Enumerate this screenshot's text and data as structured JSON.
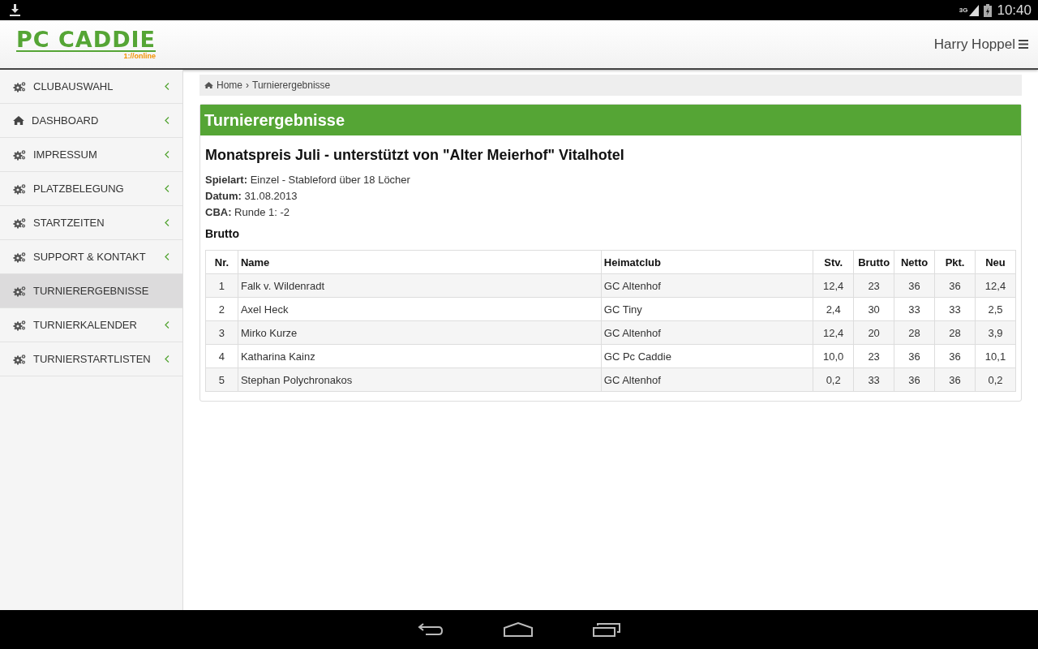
{
  "status_bar": {
    "network": "3G",
    "time": "10:40"
  },
  "header": {
    "logo": "PC CADDIE",
    "logo_sub": "1://online",
    "user": "Harry Hoppel"
  },
  "sidebar": {
    "items": [
      {
        "label": "CLUBAUSWAHL",
        "kind": "gears",
        "selected": false
      },
      {
        "label": "DASHBOARD",
        "kind": "home",
        "selected": false
      },
      {
        "label": "IMPRESSUM",
        "kind": "gears",
        "selected": false
      },
      {
        "label": "PLATZBELEGUNG",
        "kind": "gears",
        "selected": false
      },
      {
        "label": "STARTZEITEN",
        "kind": "gears",
        "selected": false
      },
      {
        "label": "SUPPORT & KONTAKT",
        "kind": "gears",
        "selected": false
      },
      {
        "label": "TURNIERERGEBNISSE",
        "kind": "gears",
        "selected": true
      },
      {
        "label": "TURNIERKALENDER",
        "kind": "gears",
        "selected": false
      },
      {
        "label": "TURNIERSTARTLISTEN",
        "kind": "gears",
        "selected": false
      }
    ]
  },
  "breadcrumb": [
    "Home",
    "›",
    "Turnierergebnisse"
  ],
  "panel": {
    "title": "Turnierergebnisse",
    "heading": "Monatspreis Juli - unterstützt von \"Alter Meierhof\" Vitalhotel",
    "details": [
      "**Spielart:** Einzel - Stableford über 18 Löcher",
      "**Datum:** 31.08.2013",
      "**CBA:** Runde 1: -2"
    ],
    "section": "Brutto",
    "table": {
      "columns": [
        {
          "label": "Nr.",
          "kind": "number"
        },
        {
          "label": "Name",
          "kind": "text"
        },
        {
          "label": "Heimatclub",
          "kind": "text"
        },
        {
          "label": "Stv.",
          "kind": "number"
        },
        {
          "label": "Brutto",
          "kind": "number"
        },
        {
          "label": "Netto",
          "kind": "number"
        },
        {
          "label": "Pkt.",
          "kind": "number"
        },
        {
          "label": "Neu",
          "kind": "number"
        }
      ],
      "rows": [
        [
          "1",
          "Falk v. Wildenradt",
          "GC Altenhof",
          "12,4",
          "23",
          "36",
          "36",
          "12,4"
        ],
        [
          "2",
          "Axel Heck",
          "GC Tiny",
          "2,4",
          "30",
          "33",
          "33",
          "2,5"
        ],
        [
          "3",
          "Mirko Kurze",
          "GC Altenhof",
          "12,4",
          "20",
          "28",
          "28",
          "3,9"
        ],
        [
          "4",
          "Katharina Kainz",
          "GC Pc Caddie",
          "10,0",
          "23",
          "36",
          "36",
          "10,1"
        ],
        [
          "5",
          "Stephan Polychronakos",
          "GC Altenhof",
          "0,2",
          "33",
          "36",
          "36",
          "0,2"
        ]
      ]
    }
  }
}
